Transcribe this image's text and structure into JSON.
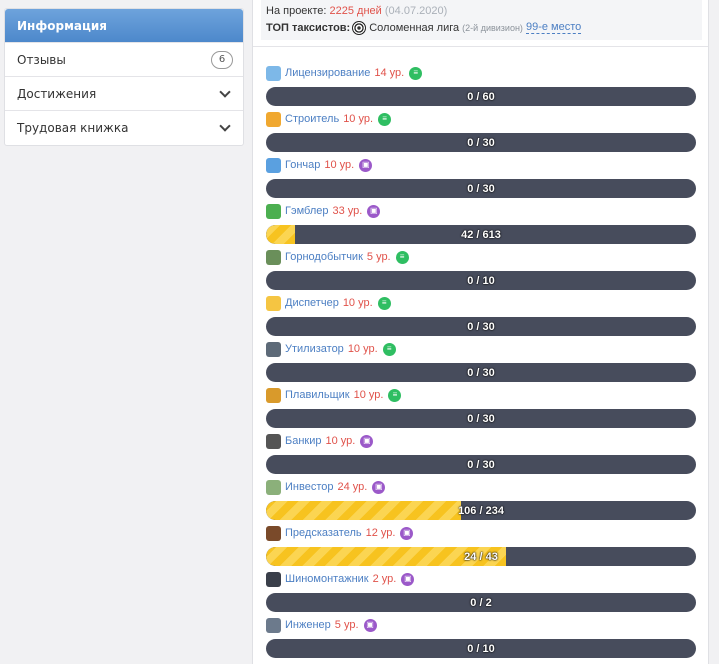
{
  "sidebar": {
    "items": [
      {
        "label": "Информация",
        "active": true
      },
      {
        "label": "Отзывы",
        "badge": "6"
      },
      {
        "label": "Достижения",
        "expandable": true
      },
      {
        "label": "Трудовая книжка",
        "expandable": true
      }
    ]
  },
  "info": {
    "on_project_label": "На проекте:",
    "on_project_days": "2225 дней",
    "on_project_date": "(04.07.2020)",
    "top_label": "ТОП таксистов:",
    "league": "Соломенная лига",
    "division": "(2-й дивизион)",
    "place": "99-е место"
  },
  "jobs": [
    {
      "name": "Лицензирование",
      "level": "14 ур.",
      "type": "list",
      "avatar": "#7db8e8",
      "progress": "0 / 60",
      "fraction": 0
    },
    {
      "name": "Строитель",
      "level": "10 ур.",
      "type": "list",
      "avatar": "#f0a830",
      "progress": "0 / 30",
      "fraction": 0
    },
    {
      "name": "Гончар",
      "level": "10 ур.",
      "type": "case",
      "avatar": "#5aa0e0",
      "progress": "0 / 30",
      "fraction": 0
    },
    {
      "name": "Гэмблер",
      "level": "33 ур.",
      "type": "case",
      "avatar": "#4caf50",
      "progress": "42 / 613",
      "fraction": 0.0685
    },
    {
      "name": "Горнодобытчик",
      "level": "5 ур.",
      "type": "list",
      "avatar": "#6a8f5a",
      "progress": "0 / 10",
      "fraction": 0
    },
    {
      "name": "Диспетчер",
      "level": "10 ур.",
      "type": "list",
      "avatar": "#f5c542",
      "progress": "0 / 30",
      "fraction": 0
    },
    {
      "name": "Утилизатор",
      "level": "10 ур.",
      "type": "list",
      "avatar": "#5d6a78",
      "progress": "0 / 30",
      "fraction": 0
    },
    {
      "name": "Плавильщик",
      "level": "10 ур.",
      "type": "list",
      "avatar": "#d99a2b",
      "progress": "0 / 30",
      "fraction": 0
    },
    {
      "name": "Банкир",
      "level": "10 ур.",
      "type": "case",
      "avatar": "#555555",
      "progress": "0 / 30",
      "fraction": 0
    },
    {
      "name": "Инвестор",
      "level": "24 ур.",
      "type": "case",
      "avatar": "#8bb07a",
      "progress": "106 / 234",
      "fraction": 0.453
    },
    {
      "name": "Предсказатель",
      "level": "12 ур.",
      "type": "case",
      "avatar": "#7a4a2a",
      "progress": "24 / 43",
      "fraction": 0.558
    },
    {
      "name": "Шиномонтажник",
      "level": "2 ур.",
      "type": "case",
      "avatar": "#3a3f4a",
      "progress": "0 / 2",
      "fraction": 0
    },
    {
      "name": "Инженер",
      "level": "5 ур.",
      "type": "case",
      "avatar": "#6c7a8c",
      "progress": "0 / 10",
      "fraction": 0
    }
  ]
}
